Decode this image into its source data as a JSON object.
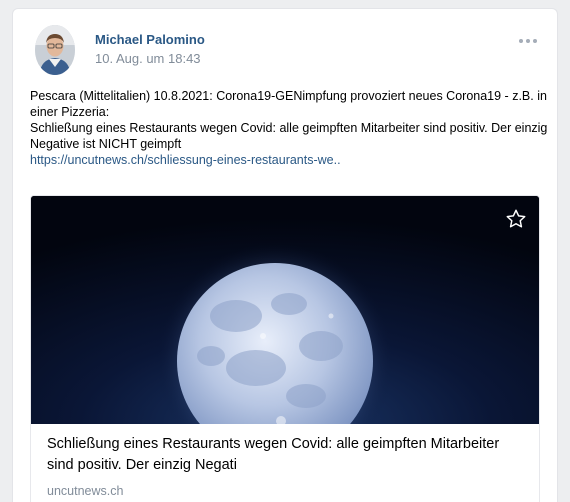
{
  "post": {
    "author": "Michael Palomino",
    "date": "10. Aug. um 18:43",
    "more_icon": "more-horizontal-icon",
    "text_lines": [
      "Pescara (Mittelitalien) 10.8.2021: Corona19-GENimpfung provoziert neues Corona19 - z.B. in einer Pizzeria:",
      "Schließung eines Restaurants wegen Covid: alle geimpften Mitarbeiter sind positiv. Der einzig Negative ist NICHT geimpft"
    ],
    "link_text": "https://uncutnews.ch/schliessung-eines-restaurants-we.."
  },
  "card": {
    "image_alt": "full-moon-image",
    "title": "Schließung eines Restaurants wegen Covid: alle geimpften Mitarbeiter sind positiv. Der einzig Negati",
    "source": "uncutnews.ch",
    "bookmark_icon": "star-icon"
  },
  "colors": {
    "link": "#2a5885",
    "secondary_text": "#818c99",
    "background": "#edeef0"
  }
}
